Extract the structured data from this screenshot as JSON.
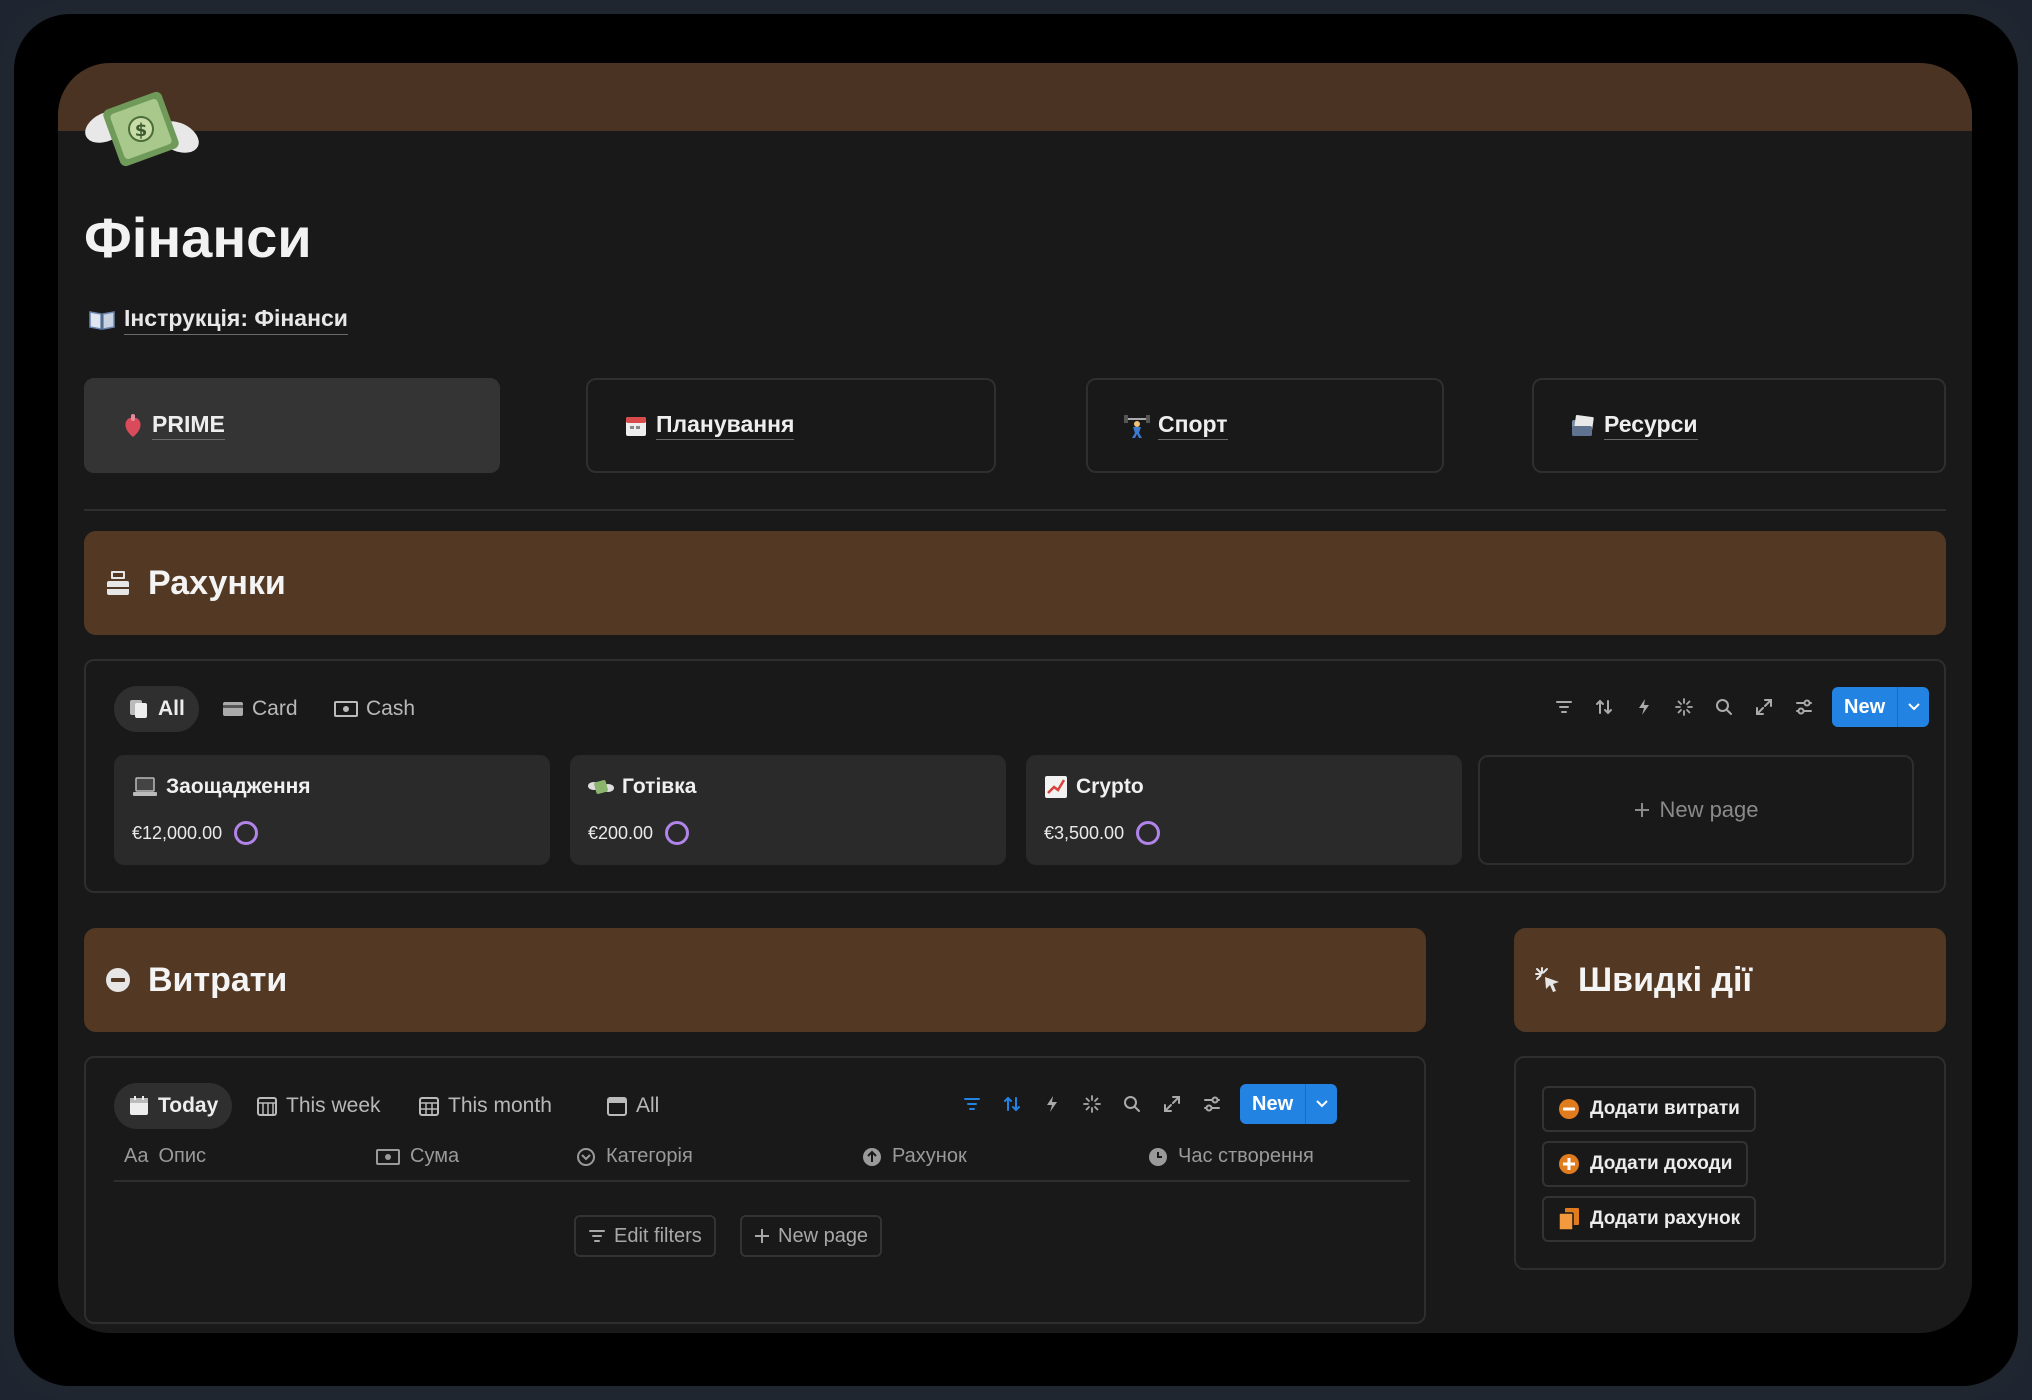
{
  "page": {
    "title": "Фінанси",
    "instruction_link": "Інструкція: Фінанси",
    "icon": "money-with-wings-icon"
  },
  "nav": [
    {
      "label": "PRIME",
      "icon": "anatomical-heart-icon",
      "active": true
    },
    {
      "label": "Планування",
      "icon": "calendar-icon",
      "active": false
    },
    {
      "label": "Спорт",
      "icon": "weightlifter-icon",
      "active": false
    },
    {
      "label": "Ресурси",
      "icon": "card-index-icon",
      "active": false
    }
  ],
  "accounts": {
    "heading": "Рахунки",
    "tabs": [
      {
        "label": "All",
        "active": true
      },
      {
        "label": "Card",
        "active": false
      },
      {
        "label": "Cash",
        "active": false
      }
    ],
    "new_label": "New",
    "cards": [
      {
        "title": "Заощадження",
        "amount": "€12,000.00",
        "icon": "laptop-icon"
      },
      {
        "title": "Готівка",
        "amount": "€200.00",
        "icon": "money-wings-icon"
      },
      {
        "title": "Crypto",
        "amount": "€3,500.00",
        "icon": "chart-up-icon"
      }
    ],
    "new_page": "New page"
  },
  "expenses": {
    "heading": "Витрати",
    "tabs": [
      {
        "label": "Today",
        "active": true
      },
      {
        "label": "This week",
        "active": false
      },
      {
        "label": "This month",
        "active": false
      },
      {
        "label": "All",
        "active": false
      }
    ],
    "new_label": "New",
    "columns": [
      "Опис",
      "Сума",
      "Категорія",
      "Рахунок",
      "Час створення"
    ],
    "column_prefix": "Aa",
    "edit_filters": "Edit filters",
    "new_page": "New page"
  },
  "quick_actions": {
    "heading": "Швидкі дії",
    "buttons": [
      {
        "label": "Додати витрати",
        "color": "#e07b1e"
      },
      {
        "label": "Додати доходи",
        "color": "#e07b1e"
      },
      {
        "label": "Додати рахунок",
        "color": "#e07b1e"
      }
    ]
  },
  "colors": {
    "accent_blue": "#2383e2",
    "banner_brown": "#533923",
    "ring_purple": "#b084e8"
  }
}
